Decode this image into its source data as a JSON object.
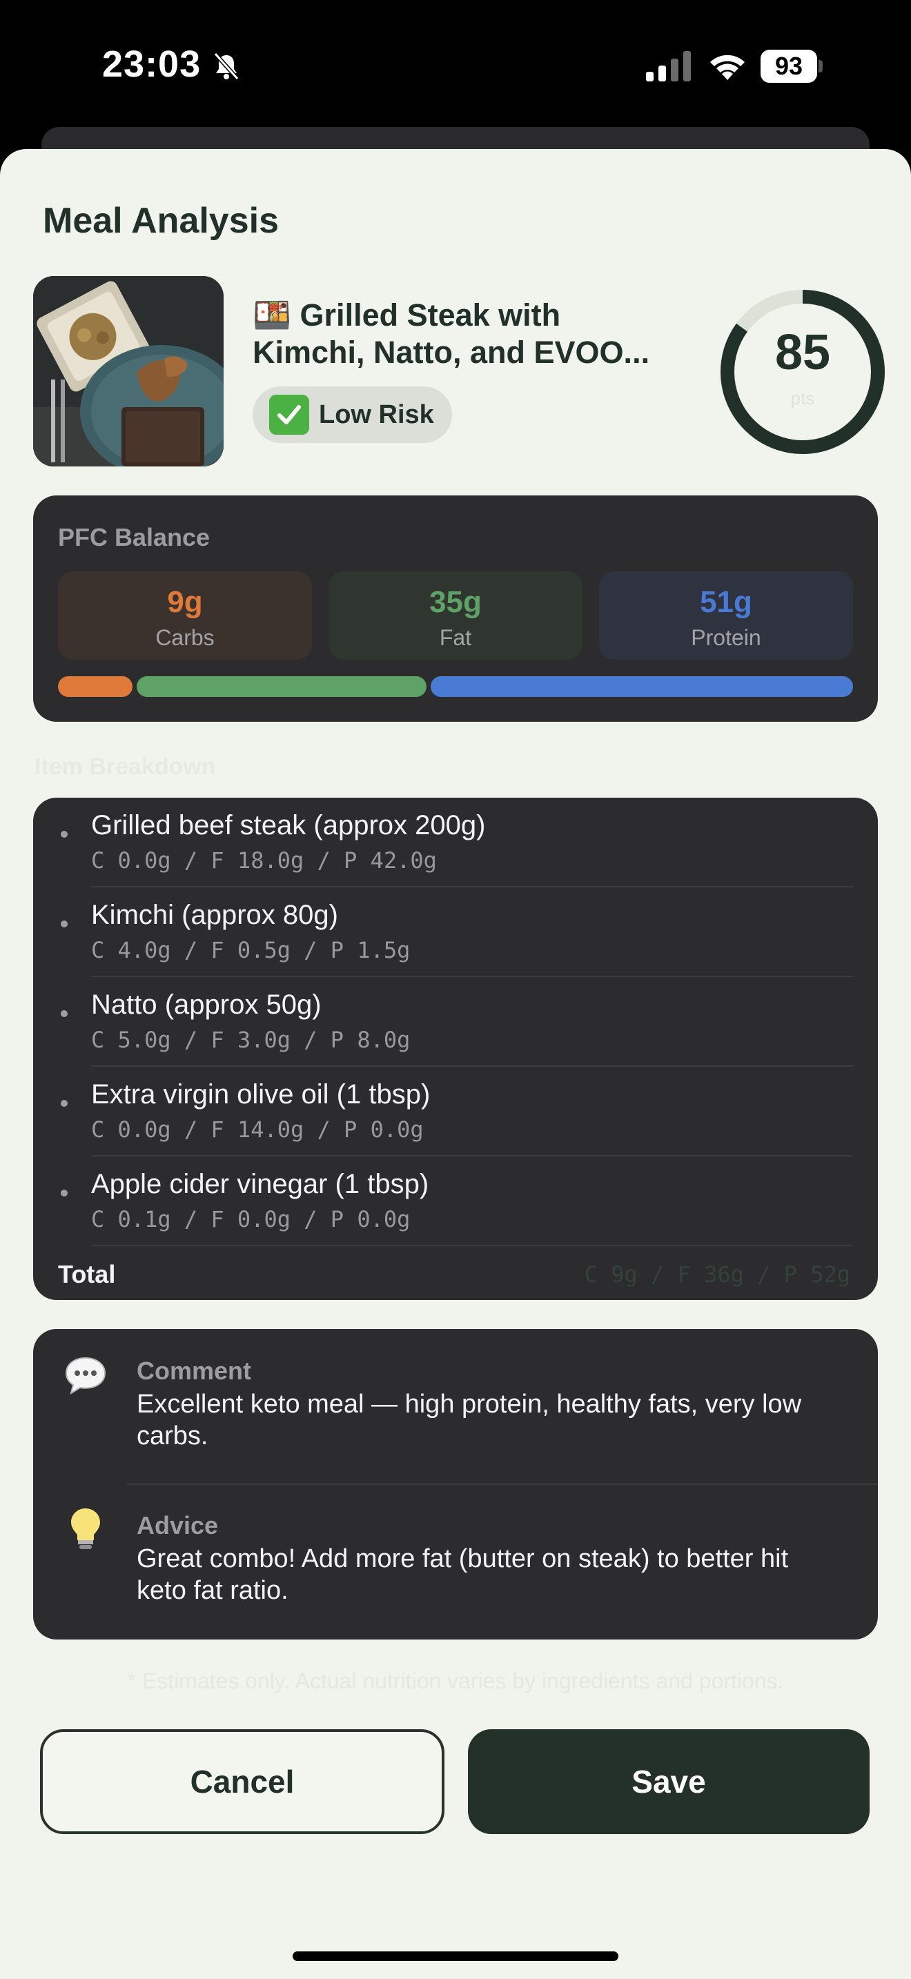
{
  "status_bar": {
    "time": "23:03",
    "battery": "93"
  },
  "sheet": {
    "title": "Meal Analysis",
    "meal": {
      "emoji": "🍱",
      "name_line1": "Grilled Steak with",
      "name_line2": "Kimchi, Natto, and EVOO...",
      "risk_label": "Low Risk",
      "score": "85",
      "score_unit": "pts",
      "score_fraction": 0.85
    },
    "pfc": {
      "title": "PFC Balance",
      "carbs": {
        "value": "9g",
        "label": "Carbs",
        "grams": 9,
        "color": "#e07a3a"
      },
      "fat": {
        "value": "35g",
        "label": "Fat",
        "grams": 35,
        "color": "#5fa267"
      },
      "protein": {
        "value": "51g",
        "label": "Protein",
        "grams": 51,
        "color": "#4a7bd4"
      }
    },
    "breakdown_label": "Item Breakdown",
    "items": [
      {
        "name": "Grilled beef steak (approx 200g)",
        "macros": "C 0.0g / F 18.0g / P 42.0g"
      },
      {
        "name": "Kimchi (approx 80g)",
        "macros": "C 4.0g / F 0.5g / P 1.5g"
      },
      {
        "name": "Natto (approx 50g)",
        "macros": "C 5.0g / F 3.0g / P 8.0g"
      },
      {
        "name": "Extra virgin olive oil (1 tbsp)",
        "macros": "C 0.0g / F 14.0g / P 0.0g"
      },
      {
        "name": "Apple cider vinegar (1 tbsp)",
        "macros": "C 0.1g / F 0.0g / P 0.0g"
      }
    ],
    "total": {
      "label": "Total",
      "values": "C 9g / F 36g / P 52g"
    },
    "comment": {
      "heading": "Comment",
      "text": "Excellent keto meal — high protein, healthy fats, very low carbs."
    },
    "advice": {
      "heading": "Advice",
      "text": "Great combo! Add more fat (butter on steak) to better hit keto fat ratio."
    },
    "disclaimer": "* Estimates only. Actual nutrition varies by ingredients and portions.",
    "cancel_label": "Cancel",
    "save_label": "Save"
  },
  "colors": {
    "accent": "#243128",
    "background": "#f0f4ec",
    "card": "#2c2c2e"
  }
}
